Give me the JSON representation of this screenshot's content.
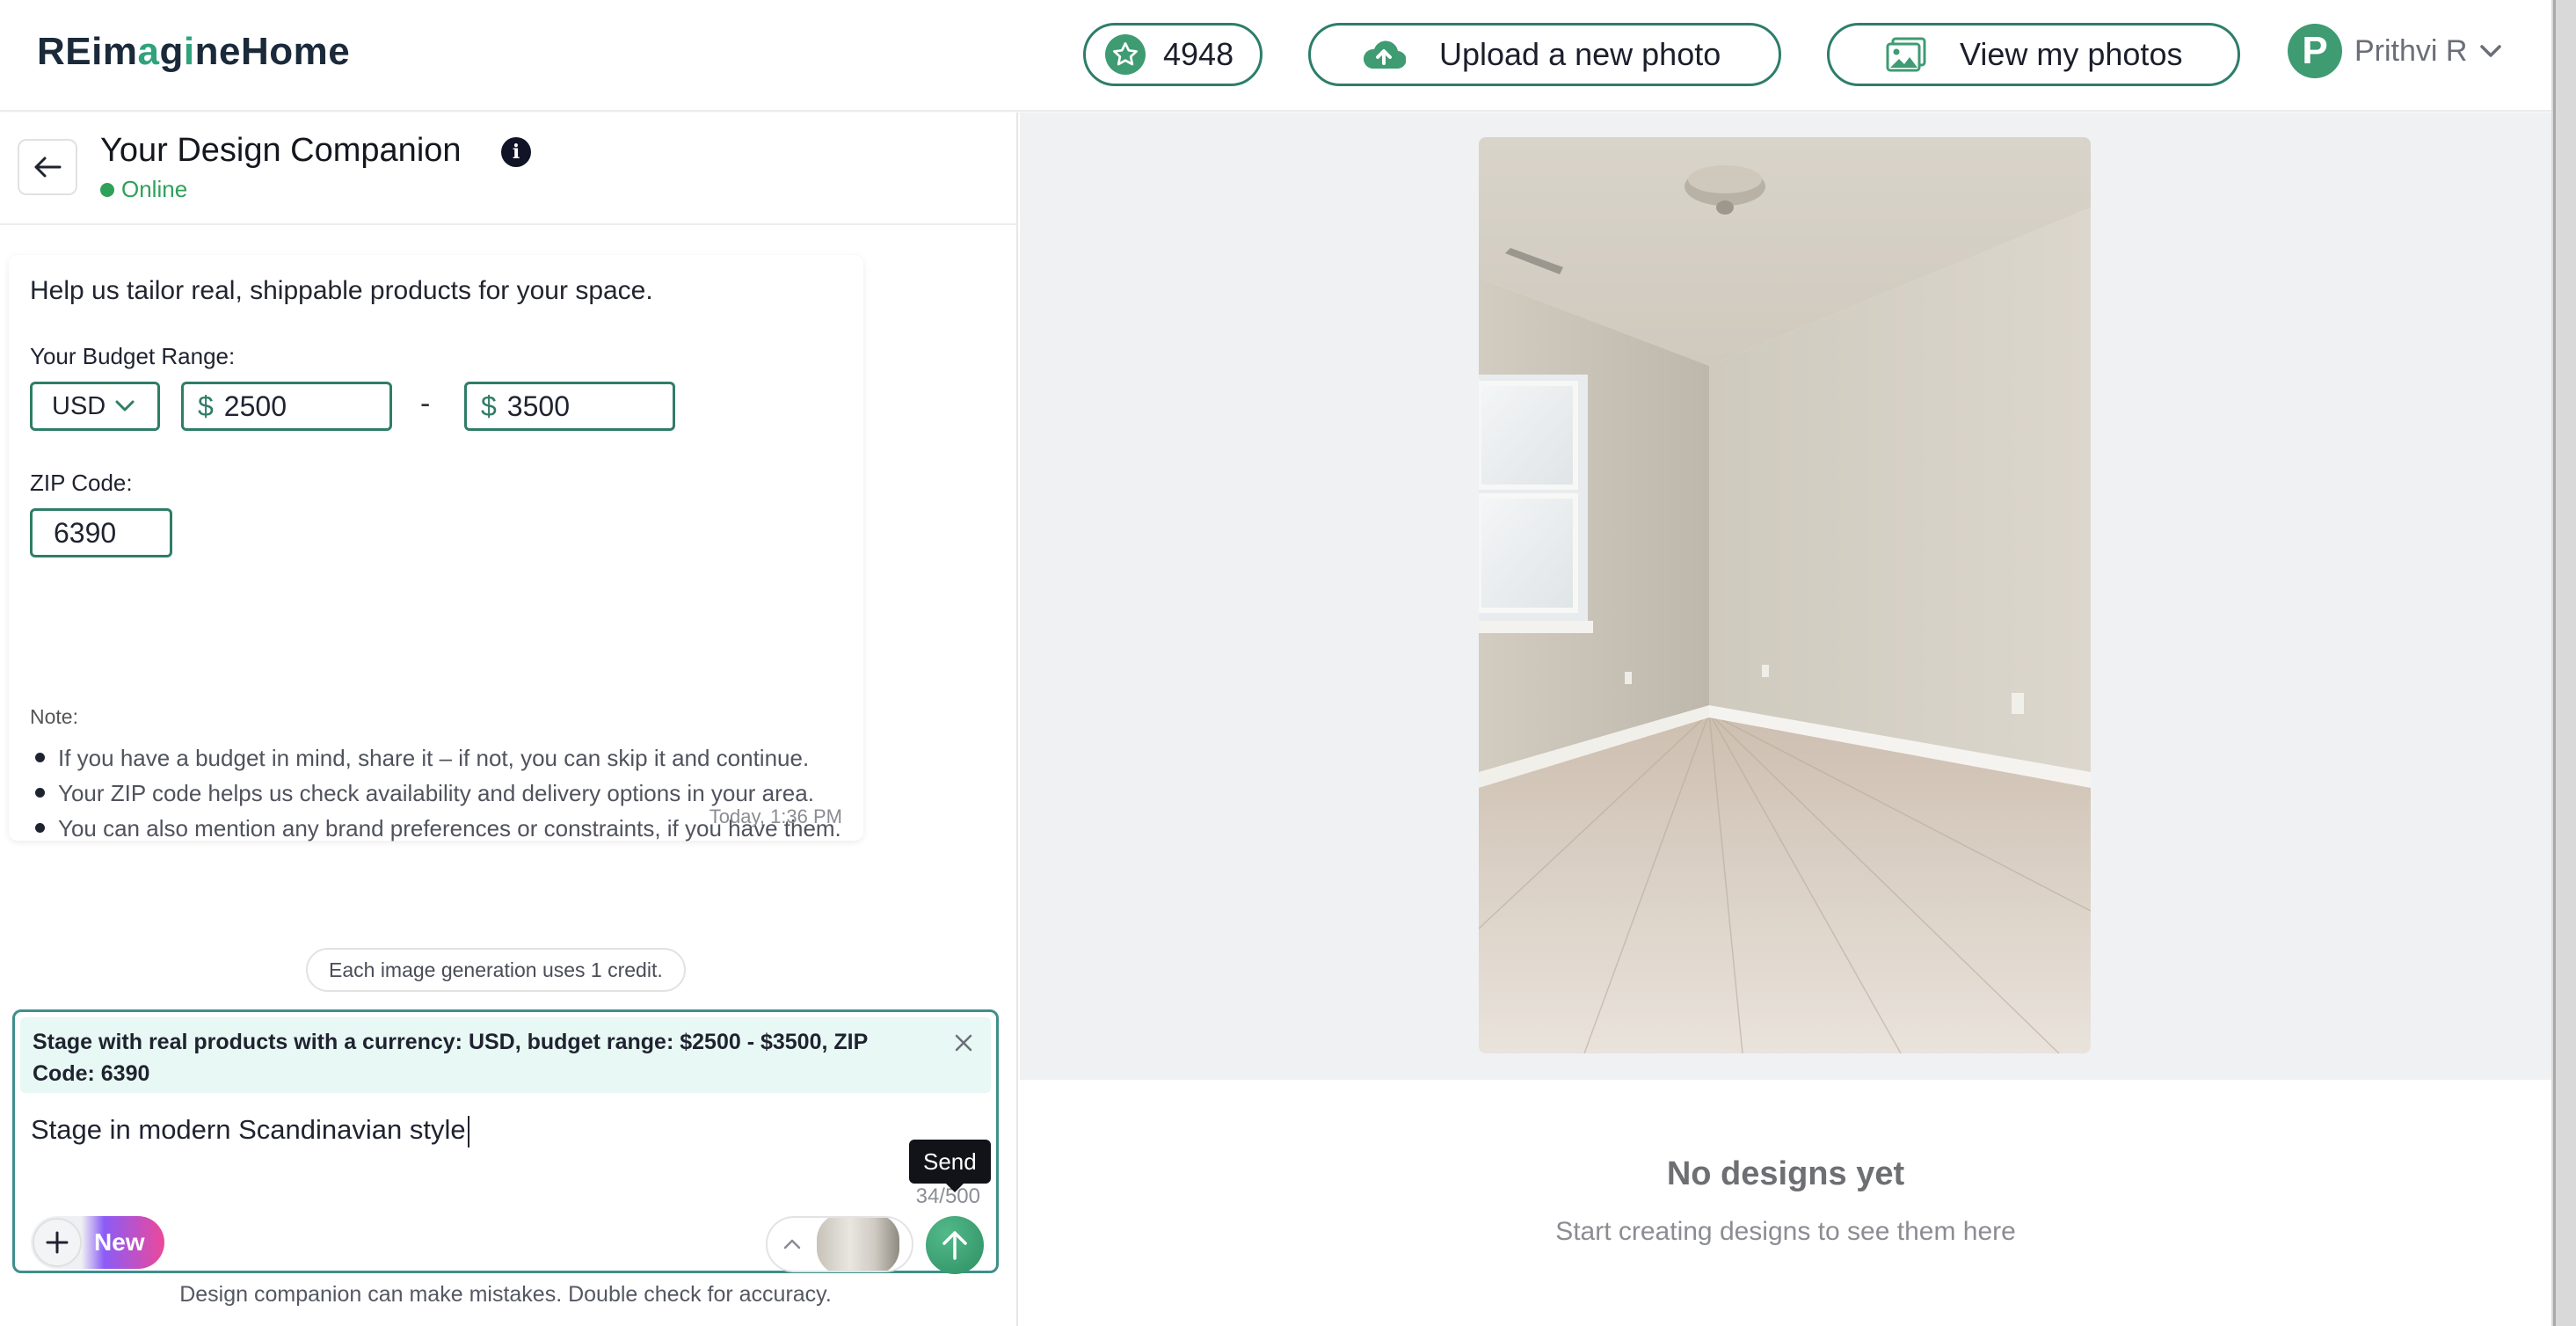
{
  "header": {
    "brand_pre": "REim",
    "brand_acc": "a",
    "brand_mid": "g",
    "brand_acc2": "i",
    "brand_post": "neHome",
    "credits": "4948",
    "upload_label": "Upload a new photo",
    "view_label": "View my photos",
    "avatar_letter": "P",
    "user_name": "Prithvi R",
    "icons": [
      "star-icon",
      "cloud-upload-icon",
      "image-gallery-icon",
      "chevron-down-icon"
    ]
  },
  "chat": {
    "title": "Your Design Companion",
    "info_glyph": "i",
    "status": "Online",
    "card": {
      "intro": "Help us tailor real, shippable products for your space.",
      "budget_label": "Your Budget Range:",
      "currency": "USD",
      "currency_symbol": "$",
      "min": "2500",
      "max": "3500",
      "range_separator": "-",
      "zip_label": "ZIP Code:",
      "zip": "6390",
      "note_label": "Note:",
      "notes": [
        "If you have a budget in mind, share it – if not, you can skip it and continue.",
        "Your ZIP code helps us check availability and delivery options in your area.",
        "You can also mention any brand preferences or constraints, if you have them."
      ],
      "timestamp": "Today, 1:36 PM"
    },
    "credit_note": "Each image generation uses 1 credit.",
    "composer": {
      "chip_text": "Stage with real products with a currency: USD, budget range: $2500 - $3500, ZIP Code: 6390",
      "prompt": "Stage in modern Scandinavian style",
      "counter": "34/500",
      "new_label": "New",
      "send_tooltip": "Send"
    },
    "disclaimer": "Design companion can make mistakes. Double check for accuracy."
  },
  "preview": {
    "empty_title": "No designs yet",
    "empty_subtitle": "Start creating designs to see them here"
  },
  "colors": {
    "accent": "#2f7d67",
    "brand_green": "#2fa37c",
    "online": "#2fa05a",
    "chip_bg": "#e8f8f4"
  }
}
